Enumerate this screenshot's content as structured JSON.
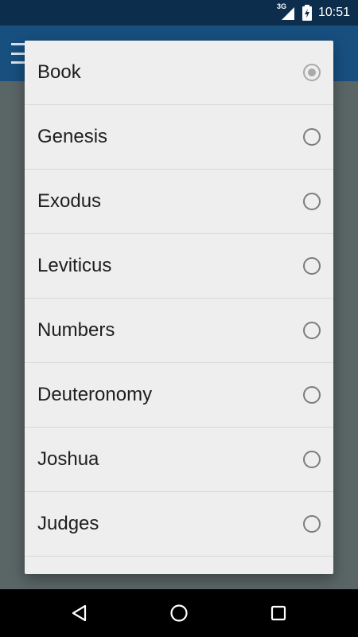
{
  "status_bar": {
    "network_label": "3G",
    "time": "10:51"
  },
  "app_bar": {
    "menu_icon": "hamburger-menu-icon"
  },
  "dialog": {
    "options": [
      {
        "label": "Book",
        "selected": true
      },
      {
        "label": "Genesis",
        "selected": false
      },
      {
        "label": "Exodus",
        "selected": false
      },
      {
        "label": "Leviticus",
        "selected": false
      },
      {
        "label": "Numbers",
        "selected": false
      },
      {
        "label": "Deuteronomy",
        "selected": false
      },
      {
        "label": "Joshua",
        "selected": false
      },
      {
        "label": "Judges",
        "selected": false
      }
    ]
  },
  "nav_bar": {
    "back_icon": "back-triangle-icon",
    "home_icon": "home-circle-icon",
    "recents_icon": "recents-square-icon"
  },
  "colors": {
    "status_bar": "#0d2d4d",
    "app_bar": "#174f7f",
    "scrim": "#5a6566",
    "dialog_bg": "#eeeeee"
  }
}
